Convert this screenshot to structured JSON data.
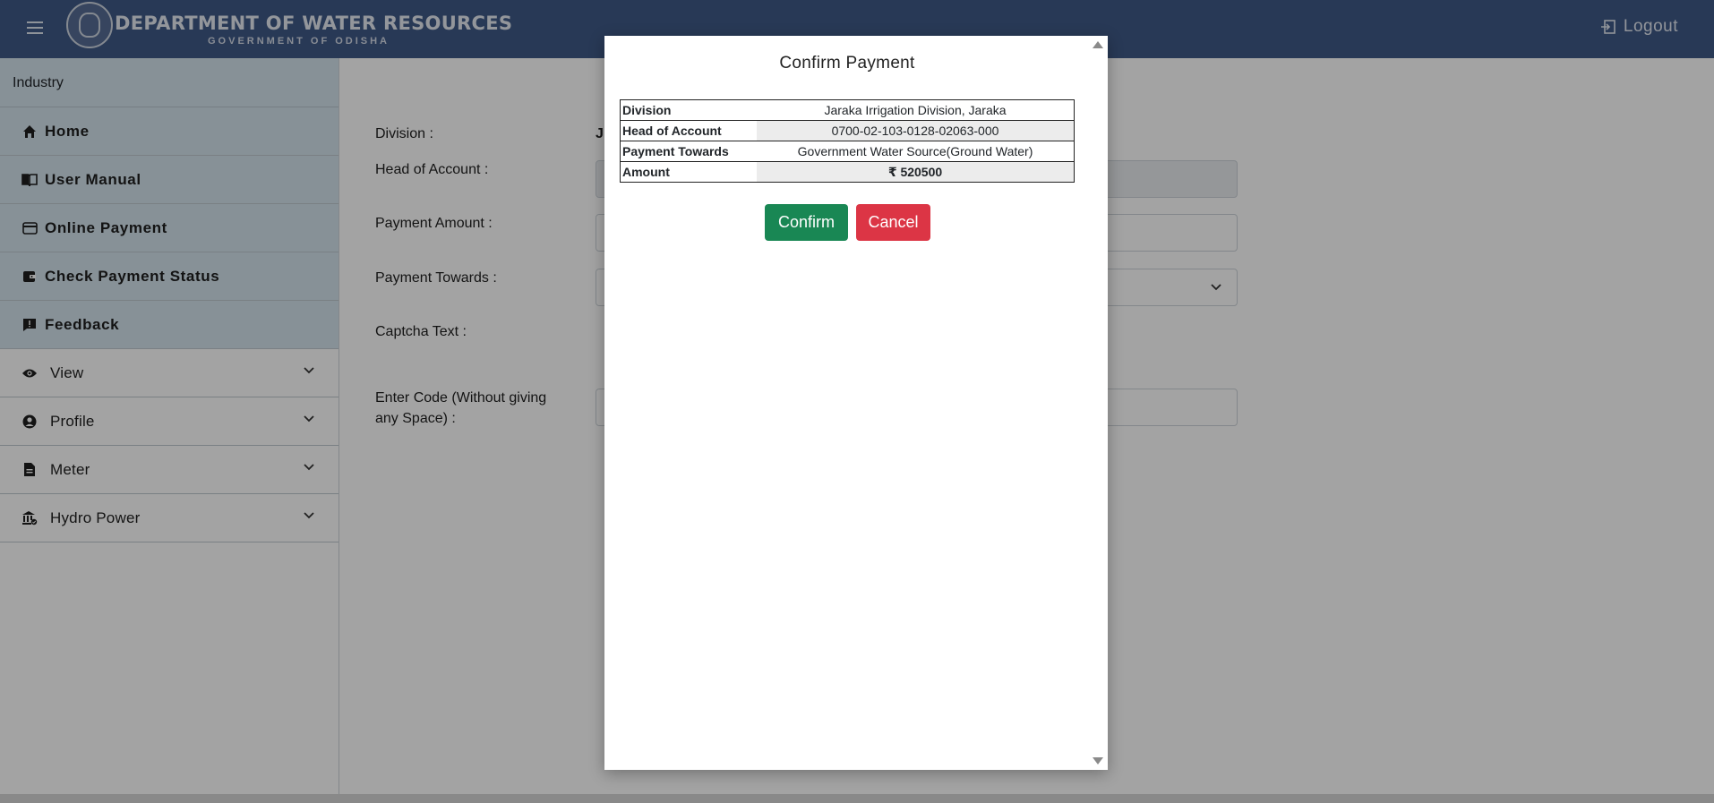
{
  "header": {
    "title": "DEPARTMENT OF WATER RESOURCES",
    "subtitle": "GOVERNMENT OF ODISHA",
    "logout_label": "Logout"
  },
  "sidebar": {
    "heading": "Industry",
    "items": [
      {
        "label": "Home",
        "icon": "home-icon"
      },
      {
        "label": "User Manual",
        "icon": "book-icon"
      },
      {
        "label": "Online Payment",
        "icon": "credit-card-icon"
      },
      {
        "label": "Check Payment Status",
        "icon": "wallet-icon"
      },
      {
        "label": "Feedback",
        "icon": "feedback-icon"
      },
      {
        "label": "View",
        "icon": "eye-icon"
      },
      {
        "label": "Profile",
        "icon": "user-circle-icon"
      },
      {
        "label": "Meter",
        "icon": "document-icon"
      },
      {
        "label": "Hydro Power",
        "icon": "bank-icon"
      }
    ]
  },
  "form": {
    "division_label": "Division :",
    "division_value_visible": "J",
    "head_of_account_label": "Head of Account :",
    "payment_amount_label": "Payment Amount :",
    "payment_towards_label": "Payment Towards :",
    "captcha_label": "Captcha Text :",
    "enter_code_label_line1": "Enter Code (Without giving",
    "enter_code_label_line2": "any Space) :"
  },
  "modal": {
    "title": "Confirm Payment",
    "rows": [
      {
        "key": "Division",
        "value": "Jaraka Irrigation Division, Jaraka"
      },
      {
        "key": "Head of Account",
        "value": "0700-02-103-0128-02063-000"
      },
      {
        "key": "Payment Towards",
        "value": "Government Water Source(Ground Water)"
      },
      {
        "key": "Amount",
        "value": "₹ 520500"
      }
    ],
    "confirm_label": "Confirm",
    "cancel_label": "Cancel"
  },
  "colors": {
    "header_bg": "#3f5a87",
    "sidebar_active_bg": "#d3e3ed",
    "confirm": "#198754",
    "cancel": "#dc3545"
  }
}
